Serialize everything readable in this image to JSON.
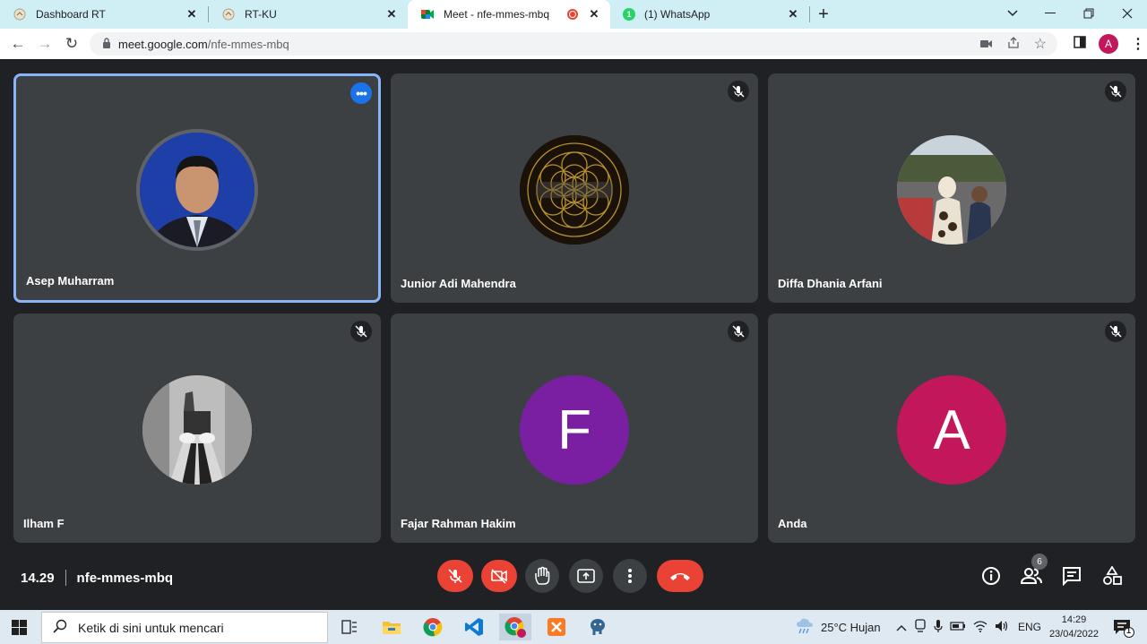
{
  "browser": {
    "tabs": [
      {
        "title": "Dashboard RT",
        "active": false
      },
      {
        "title": "RT-KU",
        "active": false
      },
      {
        "title": "Meet - nfe-mmes-mbq",
        "active": true
      },
      {
        "title": "(1) WhatsApp",
        "active": false
      }
    ],
    "whatsapp_badge": "1",
    "url_host": "meet.google.com",
    "url_path": "/nfe-mmes-mbq",
    "profile_initial": "A"
  },
  "participants": [
    {
      "name": "Asep Muharram",
      "avatar": "photo-man-suit",
      "muted": false,
      "speaking": true
    },
    {
      "name": "Junior Adi Mahendra",
      "avatar": "photo-flower-of-life",
      "muted": true
    },
    {
      "name": "Diffa Dhania Arfani",
      "avatar": "photo-outdoor-women",
      "muted": true
    },
    {
      "name": "Ilham F",
      "avatar": "photo-bw-shoes",
      "muted": true
    },
    {
      "name": "Fajar Rahman Hakim",
      "initial": "F",
      "color": "#7b1fa2",
      "muted": true
    },
    {
      "name": "Anda",
      "initial": "A",
      "color": "#c2185b",
      "muted": true
    }
  ],
  "meeting": {
    "time": "14.29",
    "code": "nfe-mmes-mbq",
    "people_count": "6"
  },
  "colors": {
    "control_red": "#ea4335",
    "tile_bg": "#3c4043",
    "stage_bg": "#202124",
    "accent_blue": "#8ab4f8"
  },
  "taskbar": {
    "search_placeholder": "Ketik di sini untuk mencari",
    "weather": "25°C  Hujan",
    "language": "ENG",
    "time": "14:29",
    "date": "23/04/2022",
    "notification_count": "1"
  }
}
